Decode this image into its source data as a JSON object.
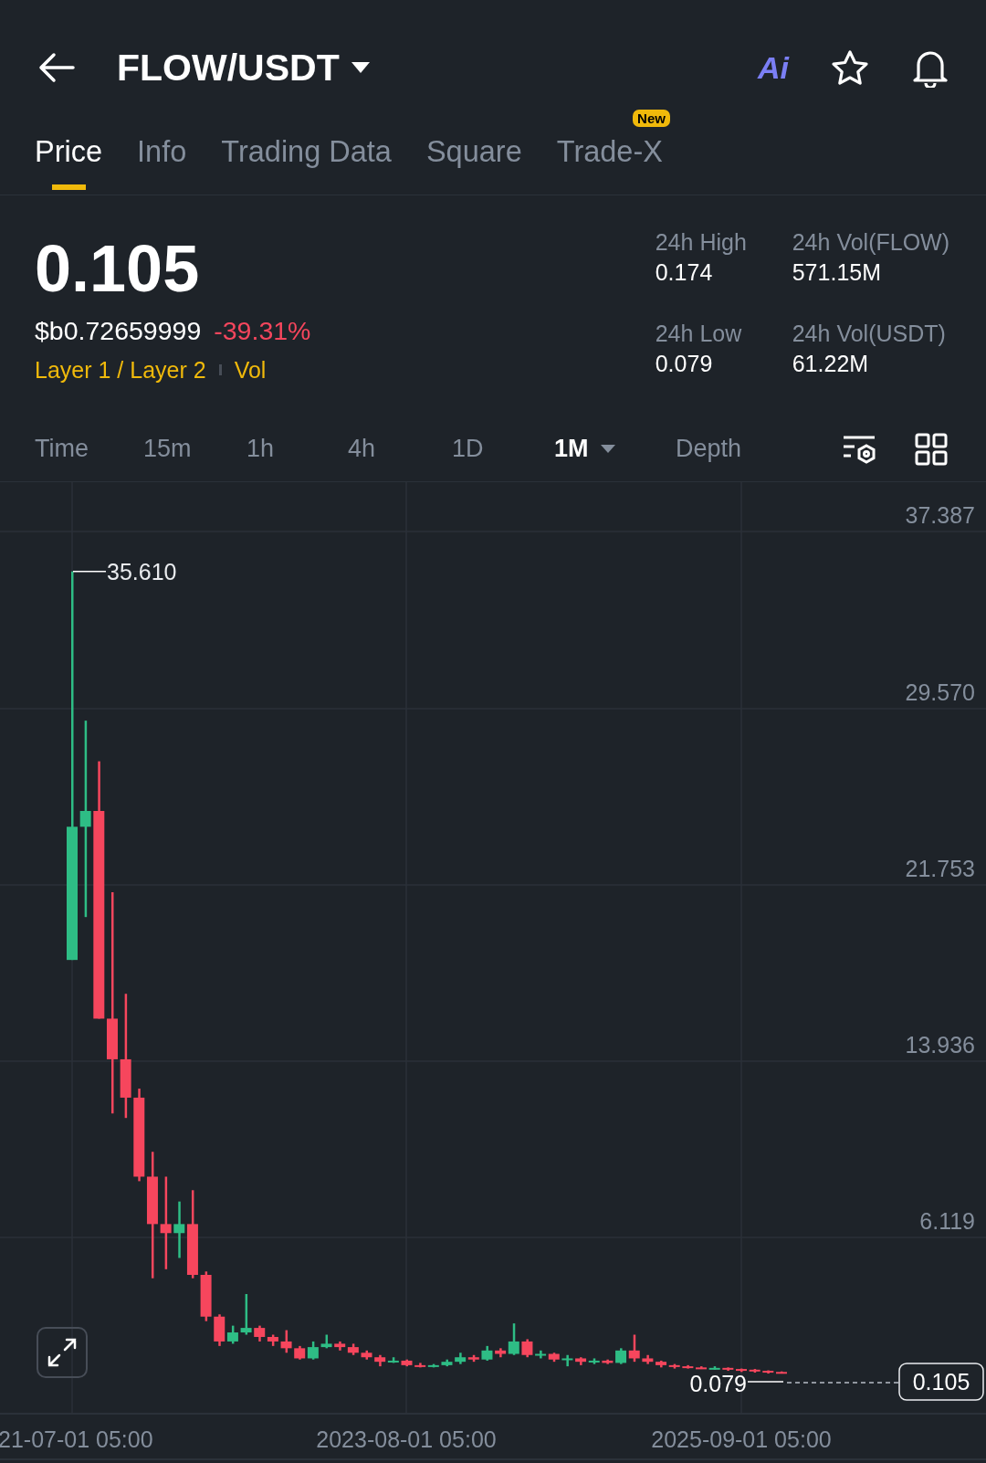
{
  "header": {
    "title": "FLOW/USDT",
    "ai_label": "Ai"
  },
  "tabs": [
    {
      "label": "Price",
      "selected": true
    },
    {
      "label": "Info",
      "selected": false
    },
    {
      "label": "Trading Data",
      "selected": false
    },
    {
      "label": "Square",
      "selected": false
    },
    {
      "label": "Trade-X",
      "selected": false,
      "badge": "New"
    }
  ],
  "ticker": {
    "price": "0.105",
    "fiat_price": "$b0.72659999",
    "change": "-39.31%",
    "tags": [
      "Layer 1 / Layer 2",
      "Vol"
    ]
  },
  "stats": [
    {
      "label": "24h High",
      "value": "0.174"
    },
    {
      "label": "24h Vol(FLOW)",
      "value": "571.15M"
    },
    {
      "label": "24h Low",
      "value": "0.079"
    },
    {
      "label": "24h Vol(USDT)",
      "value": "61.22M"
    }
  ],
  "intervals": [
    {
      "label": "Time",
      "selected": false,
      "dropdown": false
    },
    {
      "label": "15m",
      "selected": false,
      "dropdown": false
    },
    {
      "label": "1h",
      "selected": false,
      "dropdown": false
    },
    {
      "label": "4h",
      "selected": false,
      "dropdown": false
    },
    {
      "label": "1D",
      "selected": false,
      "dropdown": false
    },
    {
      "label": "1M",
      "selected": true,
      "dropdown": true
    },
    {
      "label": "Depth",
      "selected": false,
      "dropdown": false
    }
  ],
  "chart": {
    "price_labels": [
      "37.387",
      "29.570",
      "21.753",
      "13.936",
      "6.119"
    ],
    "time_labels": [
      "21-07-01 05:00",
      "2023-08-01 05:00",
      "2025-09-01 05:00"
    ],
    "high_marker": "35.610",
    "low_marker": "0.079",
    "current_price": "0.105"
  }
}
